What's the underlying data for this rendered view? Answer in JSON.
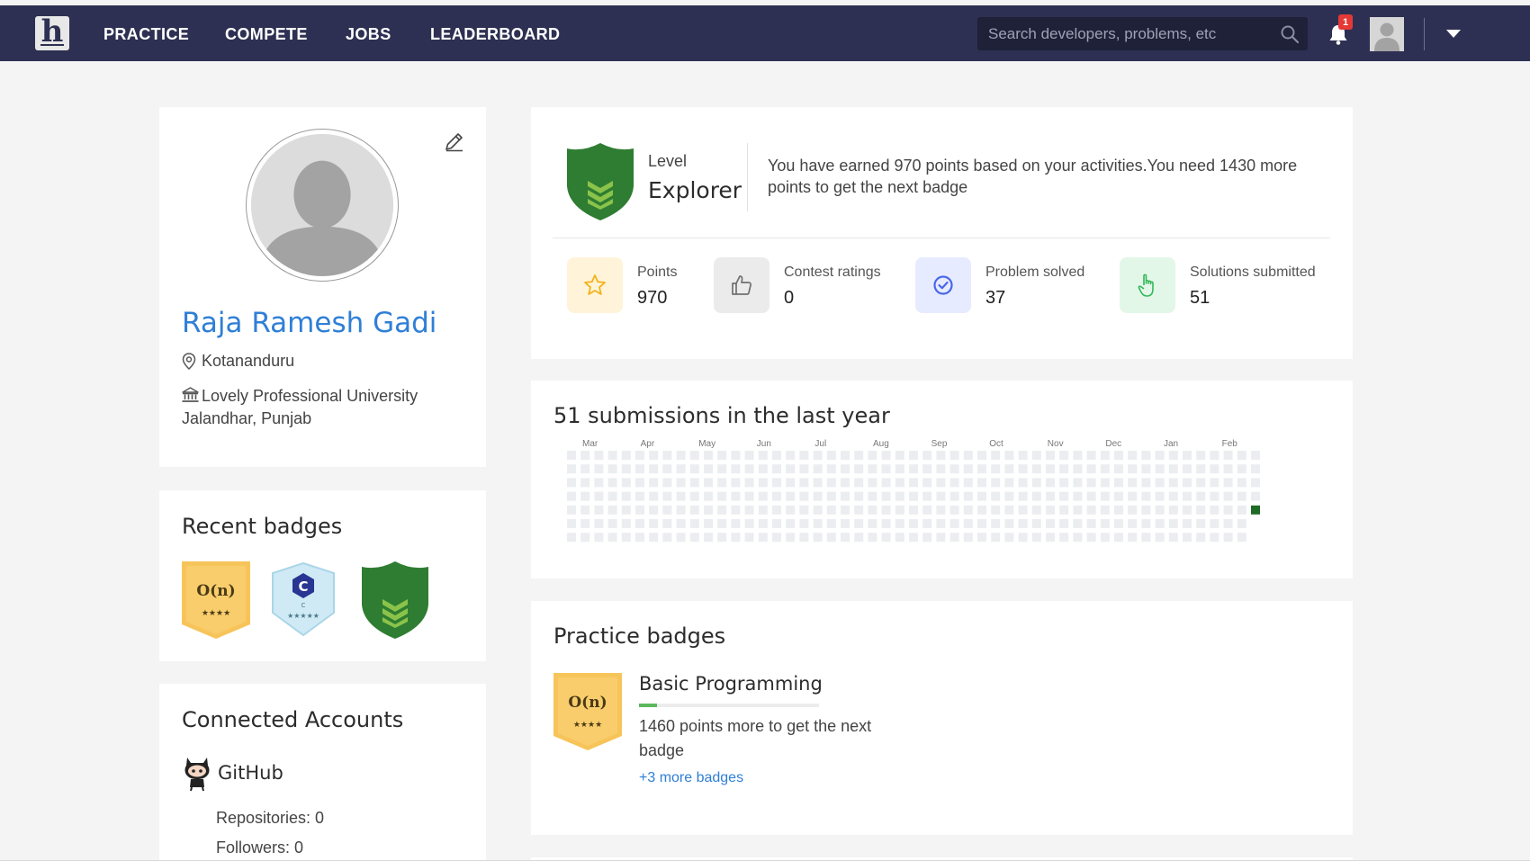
{
  "nav": {
    "logo_letter": "h",
    "items": [
      "PRACTICE",
      "COMPETE",
      "JOBS",
      "LEADERBOARD"
    ],
    "search_placeholder": "Search developers, problems, etc",
    "notification_count": "1"
  },
  "profile": {
    "name": "Raja Ramesh Gadi",
    "location": "Kotananduru",
    "university": "Lovely Professional University",
    "city": "Jalandhar, Punjab"
  },
  "recent_badges": {
    "title": "Recent badges",
    "items": [
      {
        "icon": "big-o-badge-icon",
        "text": "O(n)",
        "stars": "★★★★",
        "color": "#f7c45a"
      },
      {
        "icon": "c-language-badge-icon",
        "text": "C",
        "stars": "★★★★★",
        "color": "#cfeaf5"
      },
      {
        "icon": "explorer-level-badge-icon",
        "text": "",
        "stars": "",
        "color": "#2e7d32"
      }
    ]
  },
  "connected_accounts": {
    "title": "Connected Accounts",
    "github_label": "GitHub",
    "repositories": "Repositories: 0",
    "followers": "Followers: 0"
  },
  "level": {
    "label": "Level",
    "name": "Explorer",
    "description": "You have earned 970 points based on your activities.You need 1430 more points to get the next badge",
    "badge_color": "#2e7d32"
  },
  "stats": [
    {
      "label": "Points",
      "value": "970",
      "icon": "star-icon",
      "bg": "#fff4d9",
      "color": "#f3b21b"
    },
    {
      "label": "Contest ratings",
      "value": "0",
      "icon": "thumbs-up-icon",
      "bg": "#ebebeb",
      "color": "#707070"
    },
    {
      "label": "Problem solved",
      "value": "37",
      "icon": "check-circle-icon",
      "bg": "#e6ebff",
      "color": "#4a67e8"
    },
    {
      "label": "Solutions submitted",
      "value": "51",
      "icon": "pointer-hand-icon",
      "bg": "#e3f7e9",
      "color": "#34b85a"
    }
  ],
  "activity": {
    "title": "51 submissions in the last year",
    "months": [
      "Mar",
      "Apr",
      "May",
      "Jun",
      "Jul",
      "Aug",
      "Sep",
      "Oct",
      "Nov",
      "Dec",
      "Jan",
      "Feb"
    ],
    "weeks": 51,
    "days": 7,
    "active_cells": [
      {
        "week": 50,
        "day": 4
      }
    ],
    "empty_color": "#ebedf0",
    "active_color": "#1e6b26"
  },
  "practice_badges": {
    "title": "Practice badges",
    "badge_name": "Basic Programming",
    "badge_text": "O(n)",
    "badge_stars": "★★★★",
    "progress": 0.1,
    "progress_desc": "1460 points more to get the next badge",
    "more_link": "+3 more badges"
  }
}
